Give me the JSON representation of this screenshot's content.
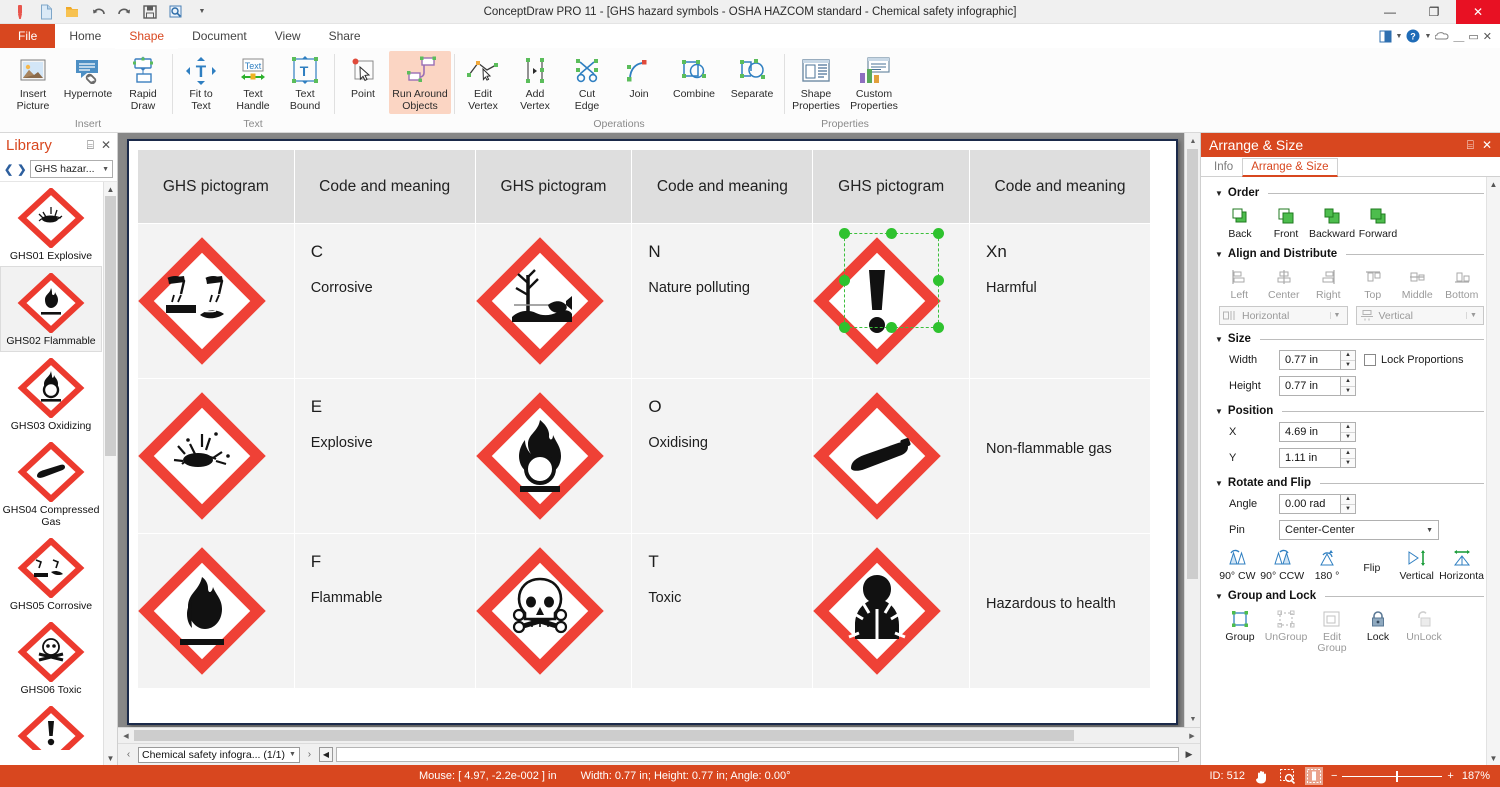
{
  "window": {
    "title": "ConceptDraw PRO 11 - [GHS hazard symbols - OSHA HAZCOM standard - Chemical safety infographic]",
    "minimize": "—",
    "maximize": "❐",
    "close": "✕"
  },
  "quick_access": [
    {
      "name": "paint-icon"
    },
    {
      "name": "new-document-icon"
    },
    {
      "name": "open-folder-icon"
    },
    {
      "name": "undo-icon"
    },
    {
      "name": "redo-icon"
    },
    {
      "name": "save-icon"
    },
    {
      "name": "preview-icon"
    }
  ],
  "menu": {
    "tabs": [
      {
        "label": "File",
        "id": "file"
      },
      {
        "label": "Home",
        "id": "home"
      },
      {
        "label": "Shape",
        "id": "shape"
      },
      {
        "label": "Document",
        "id": "document"
      },
      {
        "label": "View",
        "id": "view"
      },
      {
        "label": "Share",
        "id": "share"
      }
    ],
    "active": "Shape"
  },
  "ribbon": {
    "groups": [
      {
        "label": "Insert",
        "buttons": [
          {
            "label": "Insert\nPicture",
            "l1": "Insert",
            "l2": "Picture",
            "icon": "picture-icon"
          },
          {
            "label": "Hypernote",
            "l1": "Hypernote",
            "l2": "",
            "icon": "hypernote-icon"
          },
          {
            "label": "Rapid Draw",
            "l1": "Rapid",
            "l2": "Draw",
            "icon": "rapid-draw-icon"
          }
        ]
      },
      {
        "label": "Text",
        "buttons": [
          {
            "l1": "Fit to",
            "l2": "Text",
            "icon": "fit-to-text-icon"
          },
          {
            "l1": "Text",
            "l2": "Handle",
            "icon": "text-handle-icon"
          },
          {
            "l1": "Text",
            "l2": "Bound",
            "icon": "text-bound-icon"
          }
        ]
      },
      {
        "label": "",
        "buttons": [
          {
            "l1": "Point",
            "l2": "",
            "icon": "point-icon"
          },
          {
            "l1": "Run Around",
            "l2": "Objects",
            "icon": "run-around-objects-icon",
            "selected": true
          }
        ]
      },
      {
        "label": "Operations",
        "buttons": [
          {
            "l1": "Edit",
            "l2": "Vertex",
            "icon": "edit-vertex-icon"
          },
          {
            "l1": "Add",
            "l2": "Vertex",
            "icon": "add-vertex-icon"
          },
          {
            "l1": "Cut",
            "l2": "Edge",
            "icon": "cut-edge-icon"
          },
          {
            "l1": "Join",
            "l2": "",
            "icon": "join-icon"
          },
          {
            "l1": "Combine",
            "l2": "",
            "icon": "combine-icon"
          },
          {
            "l1": "Separate",
            "l2": "",
            "icon": "separate-icon"
          }
        ]
      },
      {
        "label": "Properties",
        "buttons": [
          {
            "l1": "Shape",
            "l2": "Properties",
            "icon": "shape-properties-icon"
          },
          {
            "l1": "Custom",
            "l2": "Properties",
            "icon": "custom-properties-icon"
          }
        ]
      }
    ]
  },
  "library": {
    "title": "Library",
    "pin": "⌸",
    "close": "✕",
    "prev": "❮",
    "next": "❯",
    "selected_library": "GHS hazar...",
    "items": [
      {
        "label": "GHS01 Explosive",
        "icon": "ghs01-explosive-icon"
      },
      {
        "label": "GHS02 Flammable",
        "icon": "ghs02-flammable-icon",
        "selected": true
      },
      {
        "label": "GHS03 Oxidizing",
        "icon": "ghs03-oxidizing-icon"
      },
      {
        "label": "GHS04 Compressed Gas",
        "icon": "ghs04-compressed-gas-icon"
      },
      {
        "label": "GHS05 Corrosive",
        "icon": "ghs05-corrosive-icon"
      },
      {
        "label": "GHS06 Toxic",
        "icon": "ghs06-toxic-icon"
      },
      {
        "label": "",
        "icon": "ghs07-harmful-icon"
      }
    ]
  },
  "document": {
    "table": {
      "headers": [
        "GHS pictogram",
        "Code and meaning",
        "GHS pictogram",
        "Code and meaning",
        "GHS pictogram",
        "Code and meaning"
      ],
      "rows": [
        [
          {
            "type": "pictogram",
            "icon": "corrosive-pictogram"
          },
          {
            "type": "meaning",
            "code": "C",
            "meaning": "Corrosive"
          },
          {
            "type": "pictogram",
            "icon": "environment-pictogram"
          },
          {
            "type": "meaning",
            "code": "N",
            "meaning": "Nature polluting"
          },
          {
            "type": "pictogram",
            "icon": "exclamation-pictogram",
            "selected": true
          },
          {
            "type": "meaning",
            "code": "Xn",
            "meaning": "Harmful"
          }
        ],
        [
          {
            "type": "pictogram",
            "icon": "explosive-pictogram"
          },
          {
            "type": "meaning",
            "code": "E",
            "meaning": "Explosive"
          },
          {
            "type": "pictogram",
            "icon": "oxidising-pictogram"
          },
          {
            "type": "meaning",
            "code": "O",
            "meaning": "Oxidising"
          },
          {
            "type": "pictogram",
            "icon": "gas-cylinder-pictogram"
          },
          {
            "type": "meaning",
            "code": "",
            "meaning": "Non-flammable gas"
          }
        ],
        [
          {
            "type": "pictogram",
            "icon": "flammable-pictogram"
          },
          {
            "type": "meaning",
            "code": "F",
            "meaning": "Flammable"
          },
          {
            "type": "pictogram",
            "icon": "skull-crossbones-pictogram"
          },
          {
            "type": "meaning",
            "code": "T",
            "meaning": "Toxic"
          },
          {
            "type": "pictogram",
            "icon": "health-hazard-pictogram"
          },
          {
            "type": "meaning",
            "code": "",
            "meaning": "Hazardous to health"
          }
        ]
      ]
    }
  },
  "tabstrip": {
    "prev": "‹",
    "next": "›",
    "tab_label": "Chemical safety infogra... (1/1)"
  },
  "statusbar": {
    "mouse": "Mouse: [ 4.97, -2.2e-002 ] in",
    "dims": "Width: 0.77 in;  Height: 0.77 in;  Angle: 0.00°",
    "id": "ID: 512",
    "zoom": "187%",
    "minus": "−",
    "plus": "+"
  },
  "panel": {
    "title": "Arrange & Size",
    "pin": "⌸",
    "close": "✕",
    "tabs": [
      {
        "label": "Info"
      },
      {
        "label": "Arrange & Size",
        "active": true
      }
    ],
    "sections": {
      "order": {
        "title": "Order",
        "buttons": [
          {
            "label": "Back",
            "icon": "send-to-back-icon"
          },
          {
            "label": "Front",
            "icon": "bring-to-front-icon"
          },
          {
            "label": "Backward",
            "icon": "send-backward-icon"
          },
          {
            "label": "Forward",
            "icon": "bring-forward-icon"
          }
        ]
      },
      "align": {
        "title": "Align and Distribute",
        "buttons": [
          {
            "label": "Left",
            "icon": "align-left-icon"
          },
          {
            "label": "Center",
            "icon": "align-center-icon"
          },
          {
            "label": "Right",
            "icon": "align-right-icon"
          },
          {
            "label": "Top",
            "icon": "align-top-icon"
          },
          {
            "label": "Middle",
            "icon": "align-middle-icon"
          },
          {
            "label": "Bottom",
            "icon": "align-bottom-icon"
          }
        ],
        "horizontal": "Horizontal",
        "vertical": "Vertical"
      },
      "size": {
        "title": "Size",
        "width_label": "Width",
        "width_value": "0.77 in",
        "height_label": "Height",
        "height_value": "0.77 in",
        "lock_label": "Lock Proportions",
        "lock_checked": false
      },
      "position": {
        "title": "Position",
        "x_label": "X",
        "x_value": "4.69 in",
        "y_label": "Y",
        "y_value": "1.11 in"
      },
      "rotate": {
        "title": "Rotate and Flip",
        "angle_label": "Angle",
        "angle_value": "0.00 rad",
        "pin_label": "Pin",
        "pin_value": "Center-Center",
        "buttons": [
          {
            "label": "90° CW",
            "icon": "rotate-cw-icon"
          },
          {
            "label": "90° CCW",
            "icon": "rotate-ccw-icon"
          },
          {
            "label": "180 °",
            "icon": "rotate-180-icon"
          },
          {
            "label": "Flip",
            "icon": "flip-label"
          },
          {
            "label": "Vertical",
            "icon": "flip-vertical-icon"
          },
          {
            "label": "Horizonta",
            "icon": "flip-horizontal-icon"
          }
        ]
      },
      "group": {
        "title": "Group and Lock",
        "buttons": [
          {
            "label": "Group",
            "icon": "group-icon"
          },
          {
            "label": "UnGroup",
            "icon": "ungroup-icon",
            "dim": true
          },
          {
            "label": "Edit Group",
            "l1": "Edit",
            "l2": "Group",
            "icon": "edit-group-icon",
            "dim": true
          },
          {
            "label": "Lock",
            "icon": "lock-icon"
          },
          {
            "label": "UnLock",
            "icon": "unlock-icon",
            "dim": true
          }
        ]
      }
    }
  },
  "colors": {
    "accent": "#d8471f",
    "hazard_red": "#ef4136",
    "selection_green": "#2ec22e",
    "header_gray": "#dedede",
    "cell_gray": "#f3f3f3"
  }
}
